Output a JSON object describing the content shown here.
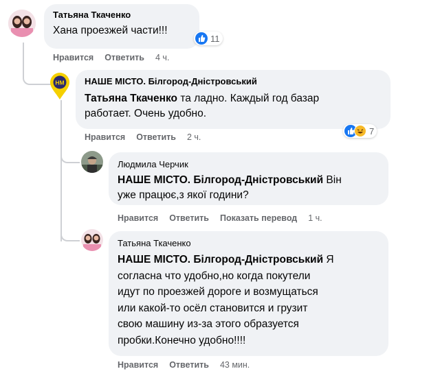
{
  "comments": [
    {
      "author": "Татьяна Ткаченко",
      "text": "Хана проезжей части!!!",
      "reactions": {
        "count": "11",
        "icons": [
          "like-icon"
        ]
      },
      "actions": {
        "like": "Нравится",
        "reply": "Ответить",
        "time": "4 ч."
      }
    },
    {
      "author": "НАШЕ МІСТО. Білгород-Дністровський",
      "mention": "Татьяна Ткаченко",
      "text_line1": " та ладно. Каждый год базар",
      "text_line2": "работает. Очень удобно.",
      "reactions": {
        "count": "7",
        "icons": [
          "like-icon",
          "haha-icon"
        ]
      },
      "actions": {
        "like": "Нравится",
        "reply": "Ответить",
        "time": "2 ч."
      }
    },
    {
      "author": "Людмила Черчик",
      "mention": "НАШЕ МІСТО. Білгород-Дністровський",
      "text_line1": " Він",
      "text_line2": "уже працює,з якої години?",
      "actions": {
        "like": "Нравится",
        "reply": "Ответить",
        "translate": "Показать перевод",
        "time": "1 ч."
      }
    },
    {
      "author": "Татьяна Ткаченко",
      "mention": "НАШЕ МІСТО. Білгород-Дністровський",
      "text_line1": " Я",
      "text_line2": "согласна что удобно,но когда покутели",
      "text_line3": "идут по проезжей дороге и возмущаться",
      "text_line4": "или какой-то осёл становится и грузит",
      "text_line5": "свою машину из-за этого образуется",
      "text_line6": "пробки.Конечно удобно!!!!",
      "actions": {
        "like": "Нравится",
        "reply": "Ответить",
        "time": "43 мин."
      }
    }
  ],
  "colors": {
    "bubble": "#f0f2f5",
    "muted": "#65676b",
    "like_blue": "#1877f2",
    "haha_yellow": "#f7b928",
    "page_logo_yellow": "#f5d000"
  }
}
